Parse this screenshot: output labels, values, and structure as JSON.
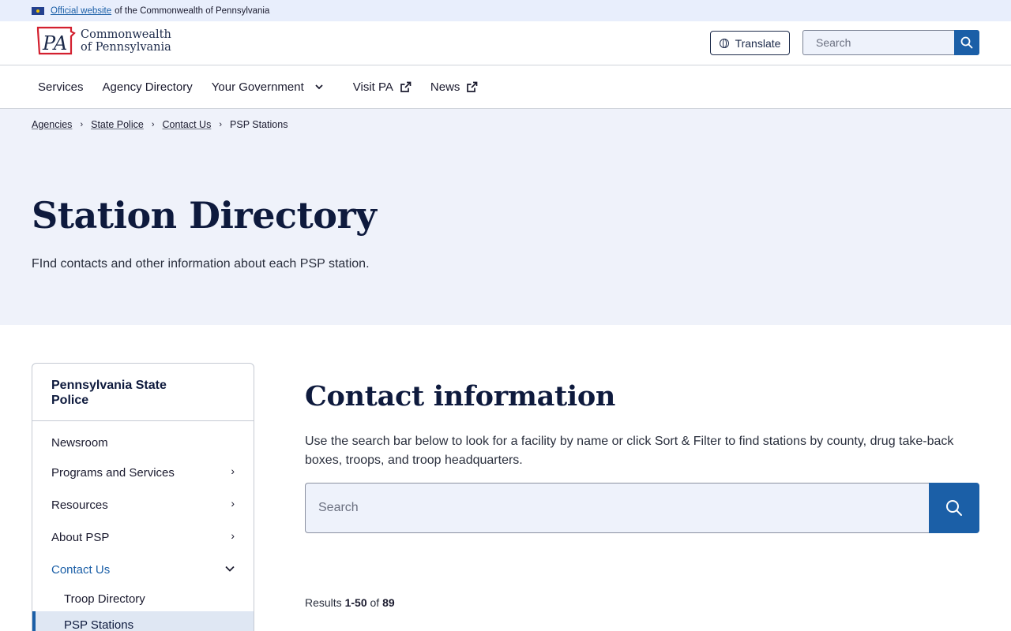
{
  "banner": {
    "link_text": "Official website",
    "rest_text": "of the Commonwealth of Pennsylvania"
  },
  "header": {
    "logo_line1": "Commonwealth",
    "logo_line2": "of Pennsylvania",
    "translate_label": "Translate",
    "search_placeholder": "Search"
  },
  "nav": {
    "items": [
      {
        "label": "Services"
      },
      {
        "label": "Agency Directory"
      },
      {
        "label": "Your Government"
      },
      {
        "label": "Visit PA"
      },
      {
        "label": "News"
      }
    ]
  },
  "breadcrumb": {
    "items": [
      "Agencies",
      "State Police",
      "Contact Us"
    ],
    "current": "PSP Stations"
  },
  "hero": {
    "title": "Station Directory",
    "subtitle": "FInd contacts and other information about each PSP station."
  },
  "sidebar": {
    "title": "Pennsylvania State Police",
    "items": [
      {
        "label": "Newsroom"
      },
      {
        "label": "Programs and Services"
      },
      {
        "label": "Resources"
      },
      {
        "label": "About PSP"
      },
      {
        "label": "Contact Us"
      }
    ],
    "subitems": [
      {
        "label": "Troop Directory"
      },
      {
        "label": "PSP Stations"
      }
    ]
  },
  "main": {
    "title": "Contact information",
    "description": "Use the search bar below to look for a facility by name or click Sort & Filter to find stations by county, drug take-back boxes, troops, and troop headquarters.",
    "search_placeholder": "Search",
    "results_prefix": "Results",
    "results_range": "1-50",
    "results_of": "of",
    "results_total": "89"
  },
  "colors": {
    "brand_blue": "#1b5fa7",
    "navy": "#0e1a3d",
    "hero_bg": "#eff2fa",
    "logo_red": "#d3202f"
  }
}
